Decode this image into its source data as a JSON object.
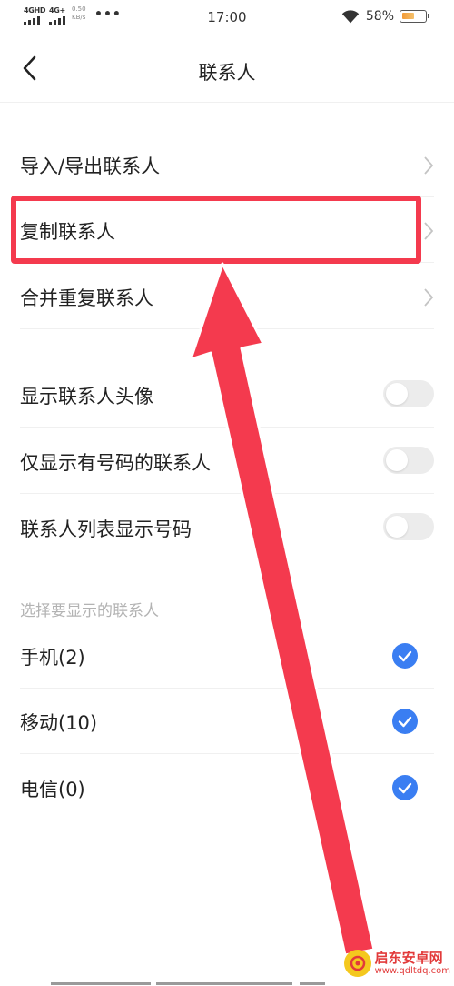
{
  "status_bar": {
    "sim1": "4GHD",
    "sim2": "4G+",
    "net_speed_value": "0.50",
    "net_speed_unit": "KB/s",
    "dots": "•••",
    "time": "17:00",
    "battery_percent": "58%",
    "battery_level": 0.58
  },
  "header": {
    "title": "联系人"
  },
  "menu": {
    "items": [
      {
        "label": "导入/导出联系人"
      },
      {
        "label": "复制联系人"
      },
      {
        "label": "合并重复联系人"
      }
    ]
  },
  "toggles": {
    "items": [
      {
        "label": "显示联系人头像",
        "on": false
      },
      {
        "label": "仅显示有号码的联系人",
        "on": false
      },
      {
        "label": "联系人列表显示号码",
        "on": false
      }
    ]
  },
  "accounts": {
    "section_title": "选择要显示的联系人",
    "items": [
      {
        "label": "手机(2)",
        "checked": true
      },
      {
        "label": "移动(10)",
        "checked": true
      },
      {
        "label": "电信(0)",
        "checked": true
      }
    ]
  },
  "watermark": {
    "name": "启东安卓网",
    "url": "www.qdltdq.com"
  },
  "colors": {
    "accent": "#3a7ef2",
    "annotation": "#f43a4e",
    "toggle_off": "#ececec",
    "section_text": "#b3b3b3"
  }
}
